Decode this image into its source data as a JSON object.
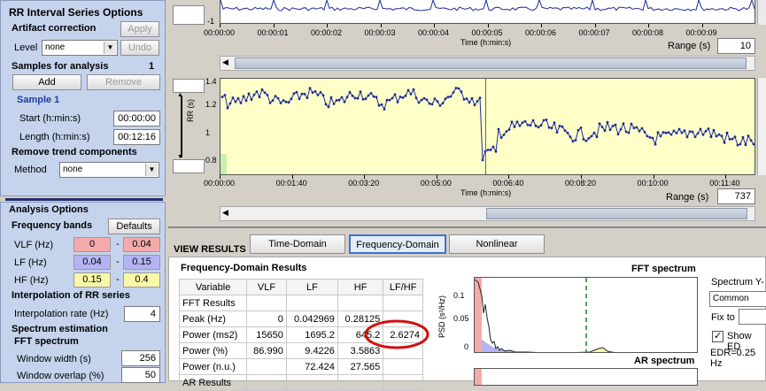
{
  "left": {
    "rr_title": "RR Interval Series Options",
    "artifact": {
      "title": "Artifact correction",
      "apply": "Apply",
      "level_label": "Level",
      "level_value": "none",
      "undo": "Undo"
    },
    "samples": {
      "title": "Samples for analysis",
      "count": "1",
      "add": "Add",
      "remove": "Remove",
      "sample_name": "Sample 1",
      "start_label": "Start (h:min:s)",
      "start_value": "00:00:00",
      "length_label": "Length (h:min:s)",
      "length_value": "00:12:16"
    },
    "trend": {
      "title": "Remove trend components",
      "method_label": "Method",
      "method_value": "none"
    },
    "analysis_title": "Analysis Options",
    "bands": {
      "title": "Frequency bands",
      "defaults": "Defaults",
      "rows": [
        {
          "label": "VLF (Hz)",
          "lo": "0",
          "hi": "0.04",
          "color": "#f4aaaa"
        },
        {
          "label": "LF (Hz)",
          "lo": "0.04",
          "hi": "0.15",
          "color": "#b4b4f4"
        },
        {
          "label": "HF (Hz)",
          "lo": "0.15",
          "hi": "0.4",
          "color": "#f8f8a8"
        }
      ],
      "dash": "-"
    },
    "interp": {
      "title": "Interpolation of RR series",
      "rate_label": "Interpolation rate (Hz)",
      "rate_value": "4"
    },
    "spectrum": {
      "title": "Spectrum estimation",
      "fft_title": "FFT spectrum",
      "window_label": "Window width (s)",
      "window_value": "256",
      "overlap_label": "Window overlap (%)",
      "overlap_value": "50"
    }
  },
  "ecg": {
    "y_labels": [
      "-1"
    ],
    "time_ticks": [
      "00:00:00",
      "00:00:01",
      "00:00:02",
      "00:00:03",
      "00:00:04",
      "00:00:05",
      "00:00:06",
      "00:00:07",
      "00:00:08",
      "00:00:09"
    ],
    "xlabel": "Time (h:min:s)",
    "range_label": "Range (s)",
    "range_value": "10"
  },
  "rr": {
    "ylabel": "RR (s)",
    "y_ticks": [
      "1.4",
      "1.2",
      "1",
      "0.8"
    ],
    "time_ticks": [
      "00:00:00",
      "00:01:40",
      "00:03:20",
      "00:05:00",
      "00:06:40",
      "00:08:20",
      "00:10:00",
      "00:11:40"
    ],
    "xlabel": "Time (h:min:s)",
    "range_label": "Range (s)",
    "range_value": "737"
  },
  "view": {
    "label": "VIEW RESULTS",
    "tabs": [
      "Time-Domain",
      "Frequency-Domain",
      "Nonlinear"
    ],
    "active_tab": 1
  },
  "results": {
    "title": "Frequency-Domain Results",
    "columns": [
      "Variable",
      "VLF",
      "LF",
      "HF",
      "LF/HF"
    ],
    "rows": [
      [
        "FFT Results",
        "",
        "",
        "",
        ""
      ],
      [
        "Peak (Hz)",
        "0",
        "0.042969",
        "0.28125",
        ""
      ],
      [
        "Power (ms2)",
        "15650",
        "1695.2",
        "645.2",
        "2.6274"
      ],
      [
        "Power (%)",
        "86.990",
        "9.4226",
        "3.5863",
        ""
      ],
      [
        "Power (n.u.)",
        "",
        "72.424",
        "27.565",
        ""
      ],
      [
        "AR Results",
        "",
        "",
        "",
        ""
      ]
    ],
    "highlight_color": "#d01010"
  },
  "fft": {
    "title": "FFT spectrum",
    "ylabel": "PSD (s²/Hz)",
    "y_ticks": [
      "0.1",
      "0.05",
      "0"
    ],
    "ar_title": "AR spectrum"
  },
  "right": {
    "spectrum_y_label": "Spectrum Y-",
    "common_value": "Common",
    "fix_to": "Fix to",
    "show_label": "Show ED",
    "edr": "EDR=0.25 Hz"
  },
  "colors": {
    "panel": "#c5d3ec",
    "navy": "#1f2e6e",
    "plot_bg": "#ffffc8",
    "trace": "#1a2a9a"
  }
}
